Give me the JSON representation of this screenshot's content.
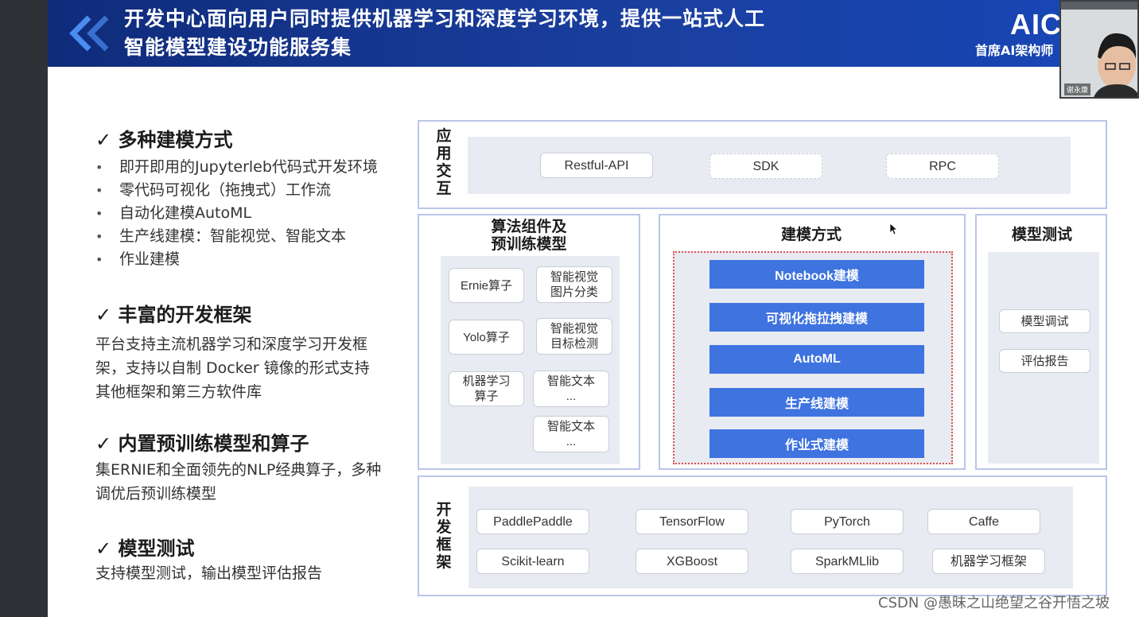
{
  "slide": {
    "title_line1": "开发中心面向用户同时提供机器学习和深度学习环境，提供一站式人工",
    "title_line2": "智能模型建设功能服务集",
    "brand": "AIC",
    "brand_sub": "首席AI架构师",
    "presenter_name": "谢永康"
  },
  "left": {
    "sections": [
      {
        "title": "✓ 多种建模方式"
      },
      {
        "title": "✓ 丰富的开发框架"
      },
      {
        "title": "✓ 内置预训练模型和算子"
      },
      {
        "title": "✓ 模型测试"
      }
    ],
    "modeling_bullets": [
      "即开即用的Jupyterleb代码式开发环境",
      "零代码可视化（拖拽式）工作流",
      "自动化建模AutoML",
      "生产线建模：智能视觉、智能文本",
      "作业建模"
    ],
    "framework_text": [
      "平台支持主流机器学习和深度学习开发框",
      "架，支持以自制 Docker 镜像的形式支持",
      "其他框架和第三方软件库"
    ],
    "pretrained_text": [
      "集ERNIE和全面领先的NLP经典算子，多种",
      "调优后预训练模型"
    ],
    "testing_text": "支持模型测试，输出模型评估报告"
  },
  "diagram": {
    "app_label": "应用交互",
    "app_items": [
      "Restful-API",
      "SDK",
      "RPC"
    ],
    "algo_head": [
      "算法组件及",
      "预训练模型"
    ],
    "algo_items": [
      "Ernie算子",
      "智能视觉\n图片分类",
      "Yolo算子",
      "智能视觉\n目标检测",
      "机器学习\n算子",
      "智能文本\n...",
      "智能文本\n..."
    ],
    "modeling_head": "建模方式",
    "modeling_items": [
      "Notebook建模",
      "可视化拖拉拽建模",
      "AutoML",
      "生产线建模",
      "作业式建模"
    ],
    "testing_head": "模型测试",
    "testing_items": [
      "模型调试",
      "评估报告"
    ],
    "framework_label": "开发框架",
    "frameworks": [
      "PaddlePaddle",
      "TensorFlow",
      "PyTorch",
      "Caffe",
      "Scikit-learn",
      "XGBoost",
      "SparkMLlib",
      "机器学习框架"
    ]
  },
  "watermark": "CSDN @愚昧之山绝望之谷开悟之坡"
}
